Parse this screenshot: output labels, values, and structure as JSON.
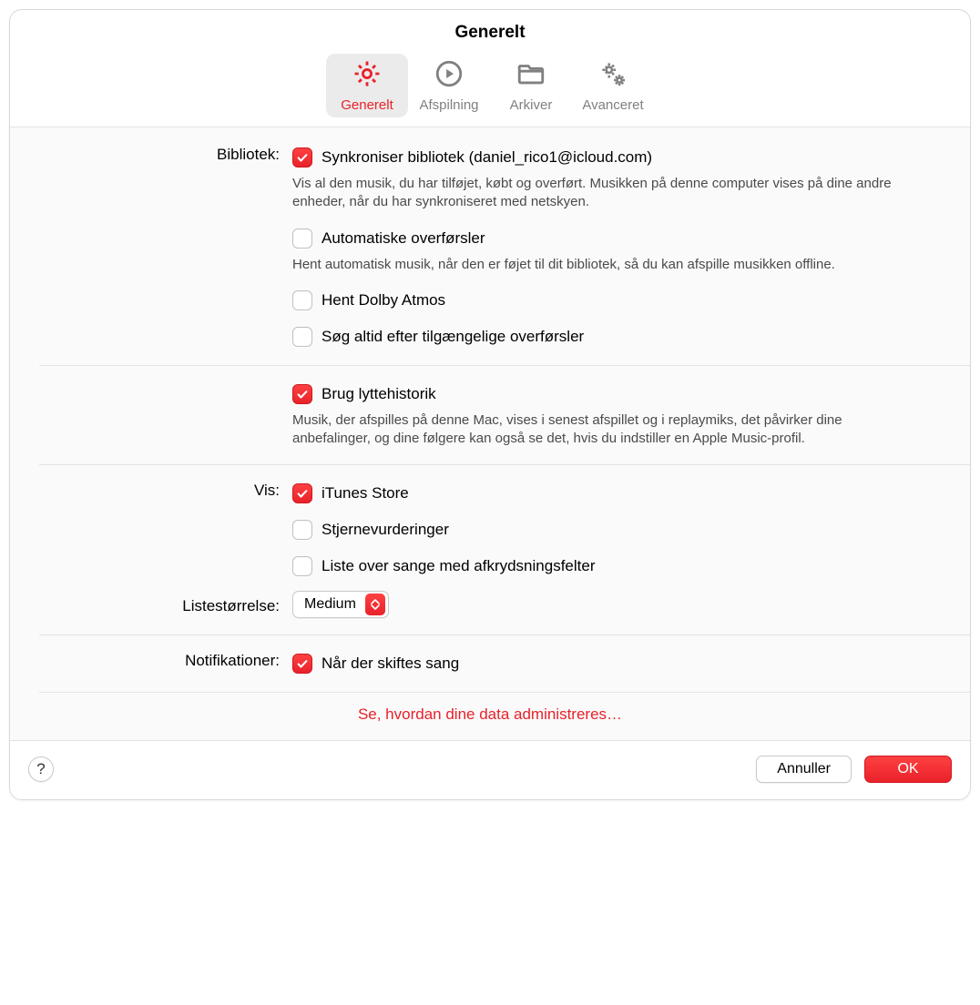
{
  "title": "Generelt",
  "tabs": {
    "general": "Generelt",
    "playback": "Afspilning",
    "files": "Arkiver",
    "advanced": "Avanceret"
  },
  "labels": {
    "library": "Bibliotek:",
    "show": "Vis:",
    "listsize": "Listestørrelse:",
    "notifications": "Notifikationer:"
  },
  "library": {
    "sync_label": "Synkroniser bibliotek (daniel_rico1@icloud.com)",
    "sync_desc": "Vis al den musik, du har tilføjet, købt og overført. Musikken på denne computer vises på dine andre enheder, når du har synkroniseret med netskyen.",
    "auto_label": "Automatiske overførsler",
    "auto_desc": "Hent automatisk musik, når den er føjet til dit bibliotek, så du kan afspille musikken offline.",
    "dolby_label": "Hent Dolby Atmos",
    "search_label": "Søg altid efter tilgængelige overførsler"
  },
  "history": {
    "label": "Brug lyttehistorik",
    "desc": "Musik, der afspilles på denne Mac, vises i senest afspillet og i replaymiks, det påvirker dine anbefalinger, og dine følgere kan også se det, hvis du indstiller en Apple Music-profil."
  },
  "show": {
    "itunes": "iTunes Store",
    "stars": "Stjernevurderinger",
    "songlist": "Liste over sange med afkrydsningsfelter"
  },
  "listsize": {
    "value": "Medium"
  },
  "notifications": {
    "label": "Når der skiftes sang"
  },
  "data_link": "Se, hvordan dine data administreres…",
  "buttons": {
    "cancel": "Annuller",
    "ok": "OK",
    "help": "?"
  }
}
